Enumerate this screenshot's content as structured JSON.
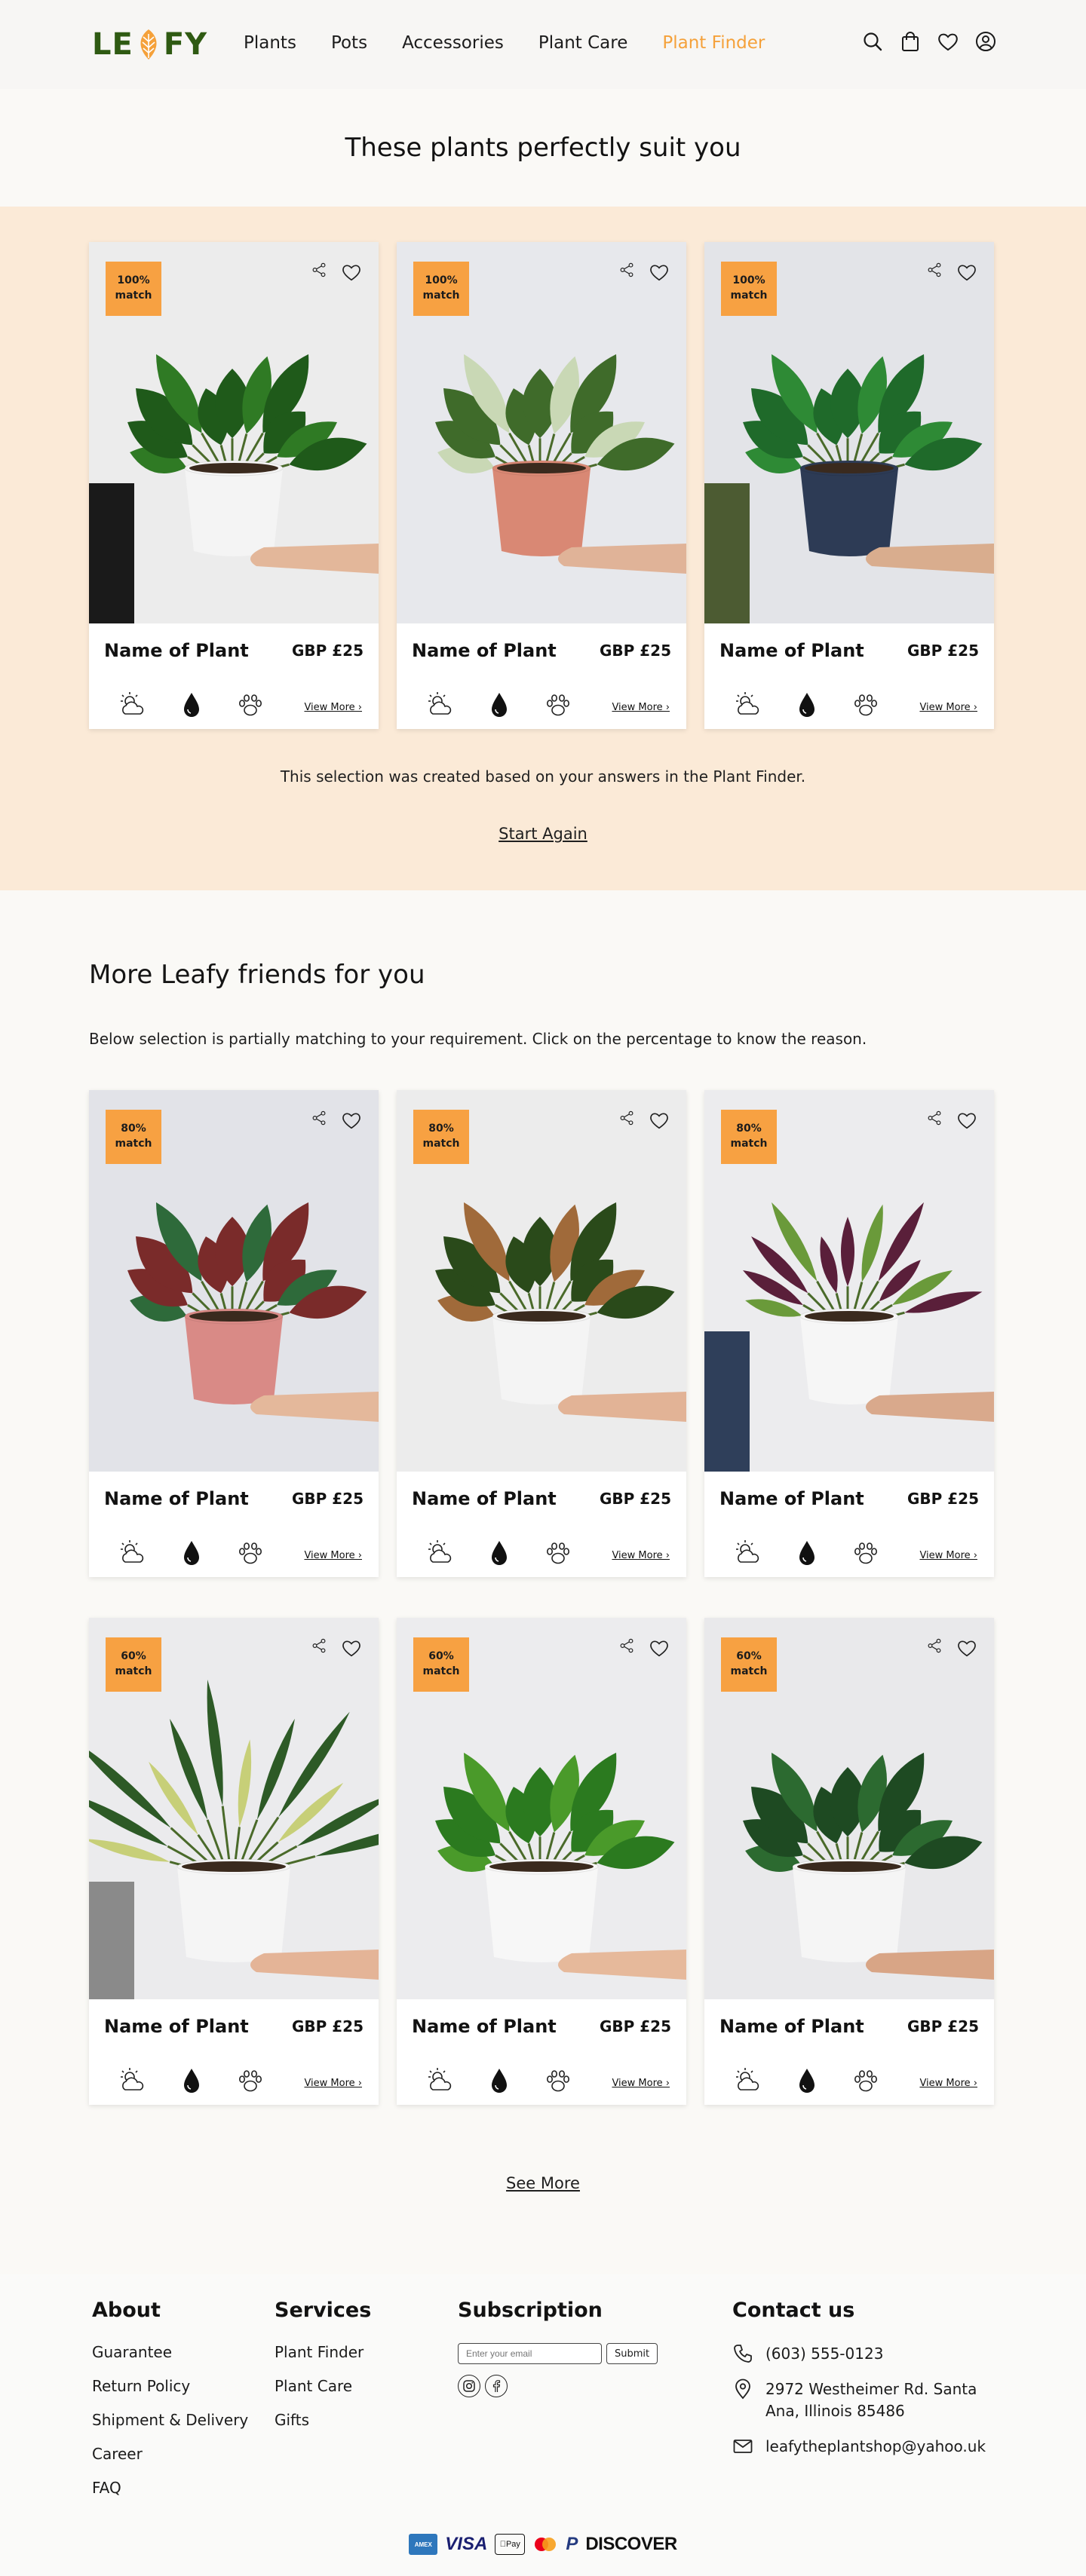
{
  "brand": {
    "name_before": "LE",
    "name_after": "FY",
    "color": "#2f5a12",
    "leaf_color": "#f5a13a"
  },
  "nav": [
    {
      "label": "Plants",
      "active": false
    },
    {
      "label": "Pots",
      "active": false
    },
    {
      "label": "Accessories",
      "active": false
    },
    {
      "label": "Plant Care",
      "active": false
    },
    {
      "label": "Plant Finder",
      "active": true
    }
  ],
  "header_icons": [
    "search-icon",
    "shopping-bag-icon",
    "heart-icon",
    "user-account-icon"
  ],
  "hero": {
    "title": "These plants perfectly suit you"
  },
  "top_matches": {
    "cards": [
      {
        "match_value": "100%",
        "match_word": "match",
        "name": "Name of Plant",
        "price": "GBP £25",
        "view_more": "View More ›",
        "plant": "philodendron"
      },
      {
        "match_value": "100%",
        "match_word": "match",
        "name": "Name of Plant",
        "price": "GBP £25",
        "view_more": "View More ›",
        "plant": "birkin"
      },
      {
        "match_value": "100%",
        "match_word": "match",
        "name": "Name of Plant",
        "price": "GBP £25",
        "view_more": "View More ›",
        "plant": "monstera"
      }
    ],
    "note": "This selection was created based on your answers in the Plant Finder.",
    "start_again": "Start Again"
  },
  "more": {
    "title": "More Leafy friends for you",
    "subtitle": "Below selection is partially matching to your requirement. Click on the percentage to know the reason.",
    "cards": [
      {
        "match_value": "80%",
        "match_word": "match",
        "name": "Name of Plant",
        "price": "GBP £25",
        "view_more": "View More ›",
        "plant": "aglaonema"
      },
      {
        "match_value": "80%",
        "match_word": "match",
        "name": "Name of Plant",
        "price": "GBP £25",
        "view_more": "View More ›",
        "plant": "rubber"
      },
      {
        "match_value": "80%",
        "match_word": "match",
        "name": "Name of Plant",
        "price": "GBP £25",
        "view_more": "View More ›",
        "plant": "calathea"
      },
      {
        "match_value": "60%",
        "match_word": "match",
        "name": "Name of Plant",
        "price": "GBP £25",
        "view_more": "View More ›",
        "plant": "snake"
      },
      {
        "match_value": "60%",
        "match_word": "match",
        "name": "Name of Plant",
        "price": "GBP £25",
        "view_more": "View More ›",
        "plant": "pothos"
      },
      {
        "match_value": "60%",
        "match_word": "match",
        "name": "Name of Plant",
        "price": "GBP £25",
        "view_more": "View More ›",
        "plant": "pilea"
      }
    ],
    "see_more": "See More"
  },
  "care_icons": [
    "sun-cloud-icon",
    "water-drop-icon",
    "paw-icon"
  ],
  "card_actions": [
    "share-icon",
    "heart-icon"
  ],
  "badge_color": "#f7a142",
  "footer": {
    "about": {
      "title": "About",
      "links": [
        "Guarantee",
        "Return Policy",
        "Shipment & Delivery",
        "Career",
        "FAQ"
      ]
    },
    "services": {
      "title": "Services",
      "links": [
        "Plant Finder",
        "Plant Care",
        "Gifts"
      ]
    },
    "subscription": {
      "title": "Subscription",
      "placeholder": "Enter your email",
      "submit": "Submit",
      "socials": [
        "instagram-icon",
        "facebook-icon"
      ]
    },
    "contact": {
      "title": "Contact us",
      "phone": "(603) 555-0123",
      "address": "2972 Westheimer Rd. Santa Ana, Illinois 85486",
      "email": "leafytheplantshop@yahoo.uk"
    },
    "payments": [
      "AMEX",
      "VISA",
      "Pay",
      "mastercard",
      "P",
      "DISCOVER"
    ]
  }
}
